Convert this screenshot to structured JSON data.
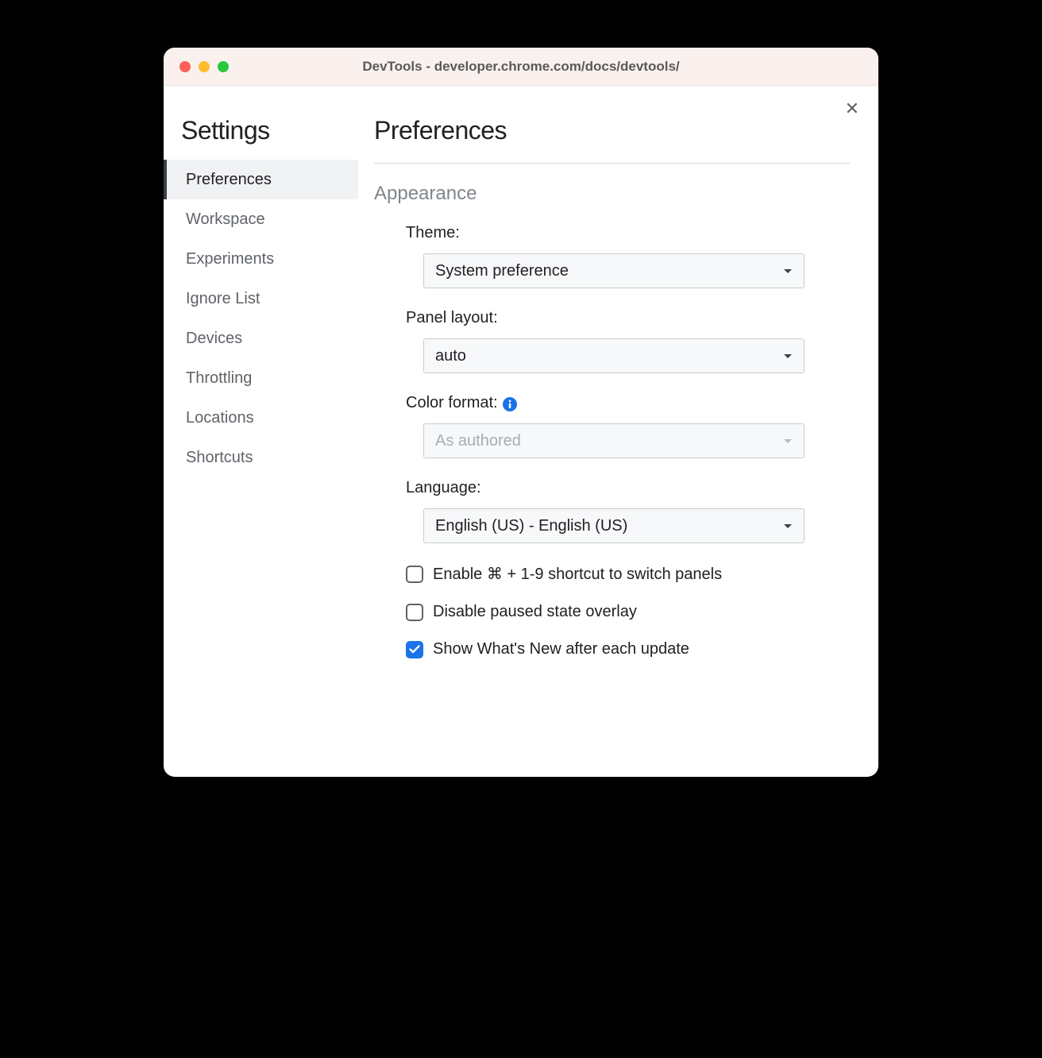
{
  "window": {
    "title": "DevTools - developer.chrome.com/docs/devtools/"
  },
  "sidebar": {
    "title": "Settings",
    "items": [
      {
        "label": "Preferences",
        "active": true
      },
      {
        "label": "Workspace",
        "active": false
      },
      {
        "label": "Experiments",
        "active": false
      },
      {
        "label": "Ignore List",
        "active": false
      },
      {
        "label": "Devices",
        "active": false
      },
      {
        "label": "Throttling",
        "active": false
      },
      {
        "label": "Locations",
        "active": false
      },
      {
        "label": "Shortcuts",
        "active": false
      }
    ]
  },
  "main": {
    "title": "Preferences",
    "section": "Appearance",
    "theme": {
      "label": "Theme:",
      "value": "System preference"
    },
    "panel_layout": {
      "label": "Panel layout:",
      "value": "auto"
    },
    "color_format": {
      "label": "Color format:",
      "value": "As authored",
      "disabled": true
    },
    "language": {
      "label": "Language:",
      "value": "English (US) - English (US)"
    },
    "checkboxes": [
      {
        "label": "Enable ⌘ + 1-9 shortcut to switch panels",
        "checked": false
      },
      {
        "label": "Disable paused state overlay",
        "checked": false
      },
      {
        "label": "Show What's New after each update",
        "checked": true
      }
    ]
  }
}
